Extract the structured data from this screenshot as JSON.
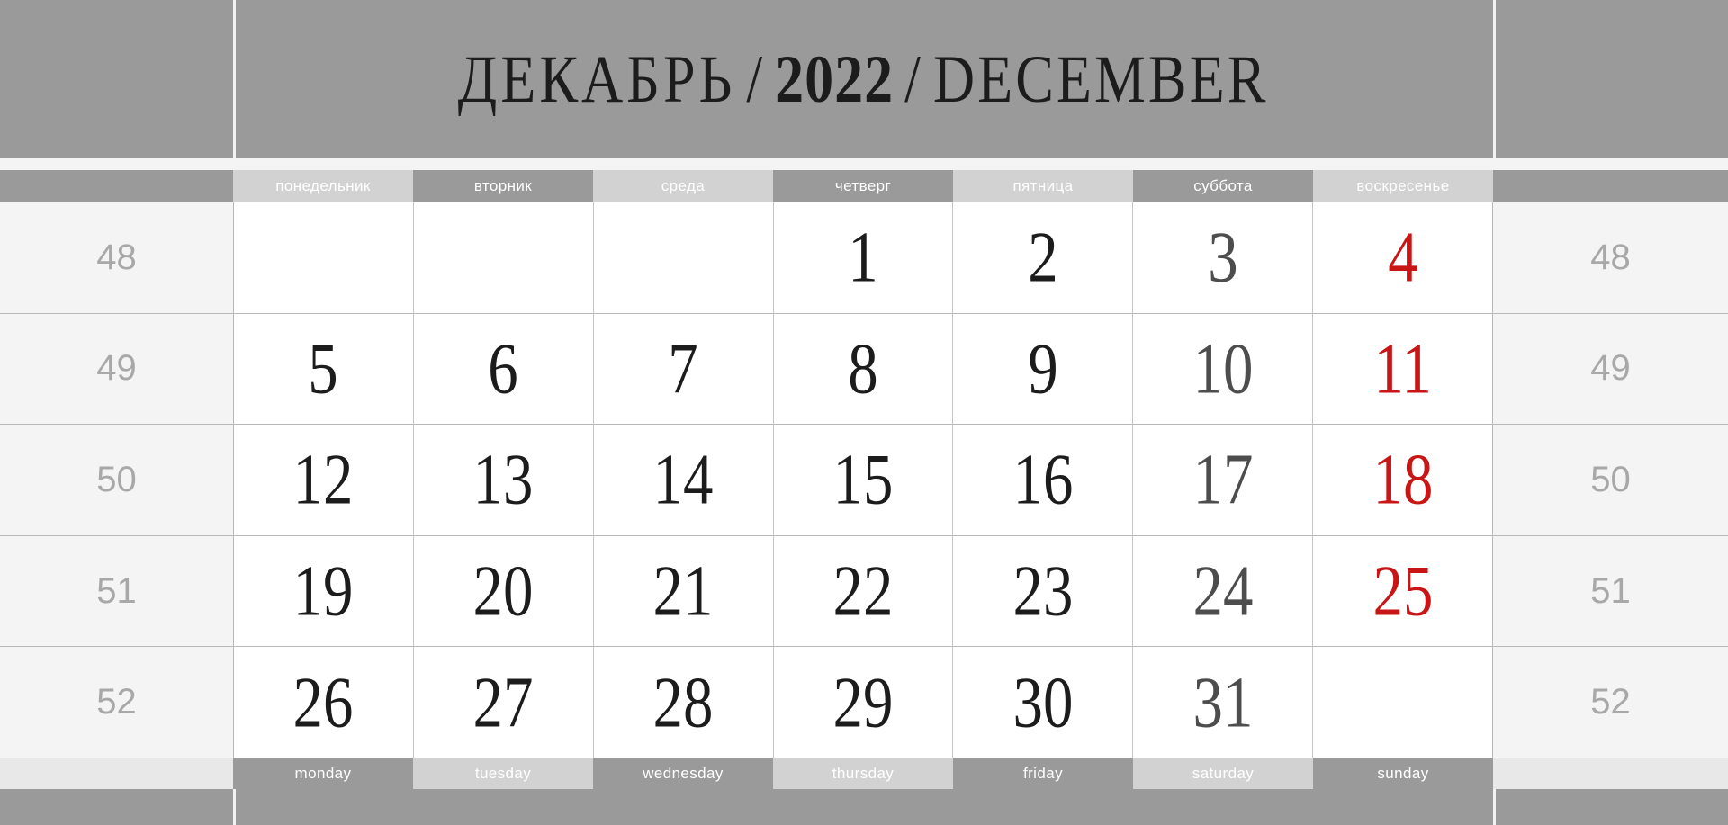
{
  "calendar": {
    "title": {
      "month_ru": "ДЕКАБРЬ",
      "separator_left": "/",
      "year": "2022",
      "separator_right": "/",
      "month_en": "DECEMBER"
    },
    "colors": {
      "header_gray": "#9a9a9a",
      "chip_light": "#d2d2d2",
      "chip_dark": "#9a9a9a",
      "weeknum_bg": "#f4f4f4",
      "weeknum_text": "#a8a8a8",
      "weekday_text": "#ffffff",
      "day_text": "#1c1c1c",
      "saturday_text": "#4d4d4d",
      "sunday_text": "#c81515",
      "cell_bg": "#ffffff",
      "grid_line": "#c4c4c4"
    },
    "weekdays_ru": [
      "понедельник",
      "вторник",
      "среда",
      "четверг",
      "пятница",
      "суббота",
      "воскресенье"
    ],
    "weekdays_en": [
      "monday",
      "tuesday",
      "wednesday",
      "thursday",
      "friday",
      "saturday",
      "sunday"
    ],
    "week_numbers": [
      "48",
      "49",
      "50",
      "51",
      "52"
    ],
    "weeks": [
      {
        "week": "48",
        "days": [
          "",
          "",
          "",
          "1",
          "2",
          "3",
          "4"
        ]
      },
      {
        "week": "49",
        "days": [
          "5",
          "6",
          "7",
          "8",
          "9",
          "10",
          "11"
        ]
      },
      {
        "week": "50",
        "days": [
          "12",
          "13",
          "14",
          "15",
          "16",
          "17",
          "18"
        ]
      },
      {
        "week": "51",
        "days": [
          "19",
          "20",
          "21",
          "22",
          "23",
          "24",
          "25"
        ]
      },
      {
        "week": "52",
        "days": [
          "26",
          "27",
          "28",
          "29",
          "30",
          "31",
          ""
        ]
      }
    ]
  }
}
